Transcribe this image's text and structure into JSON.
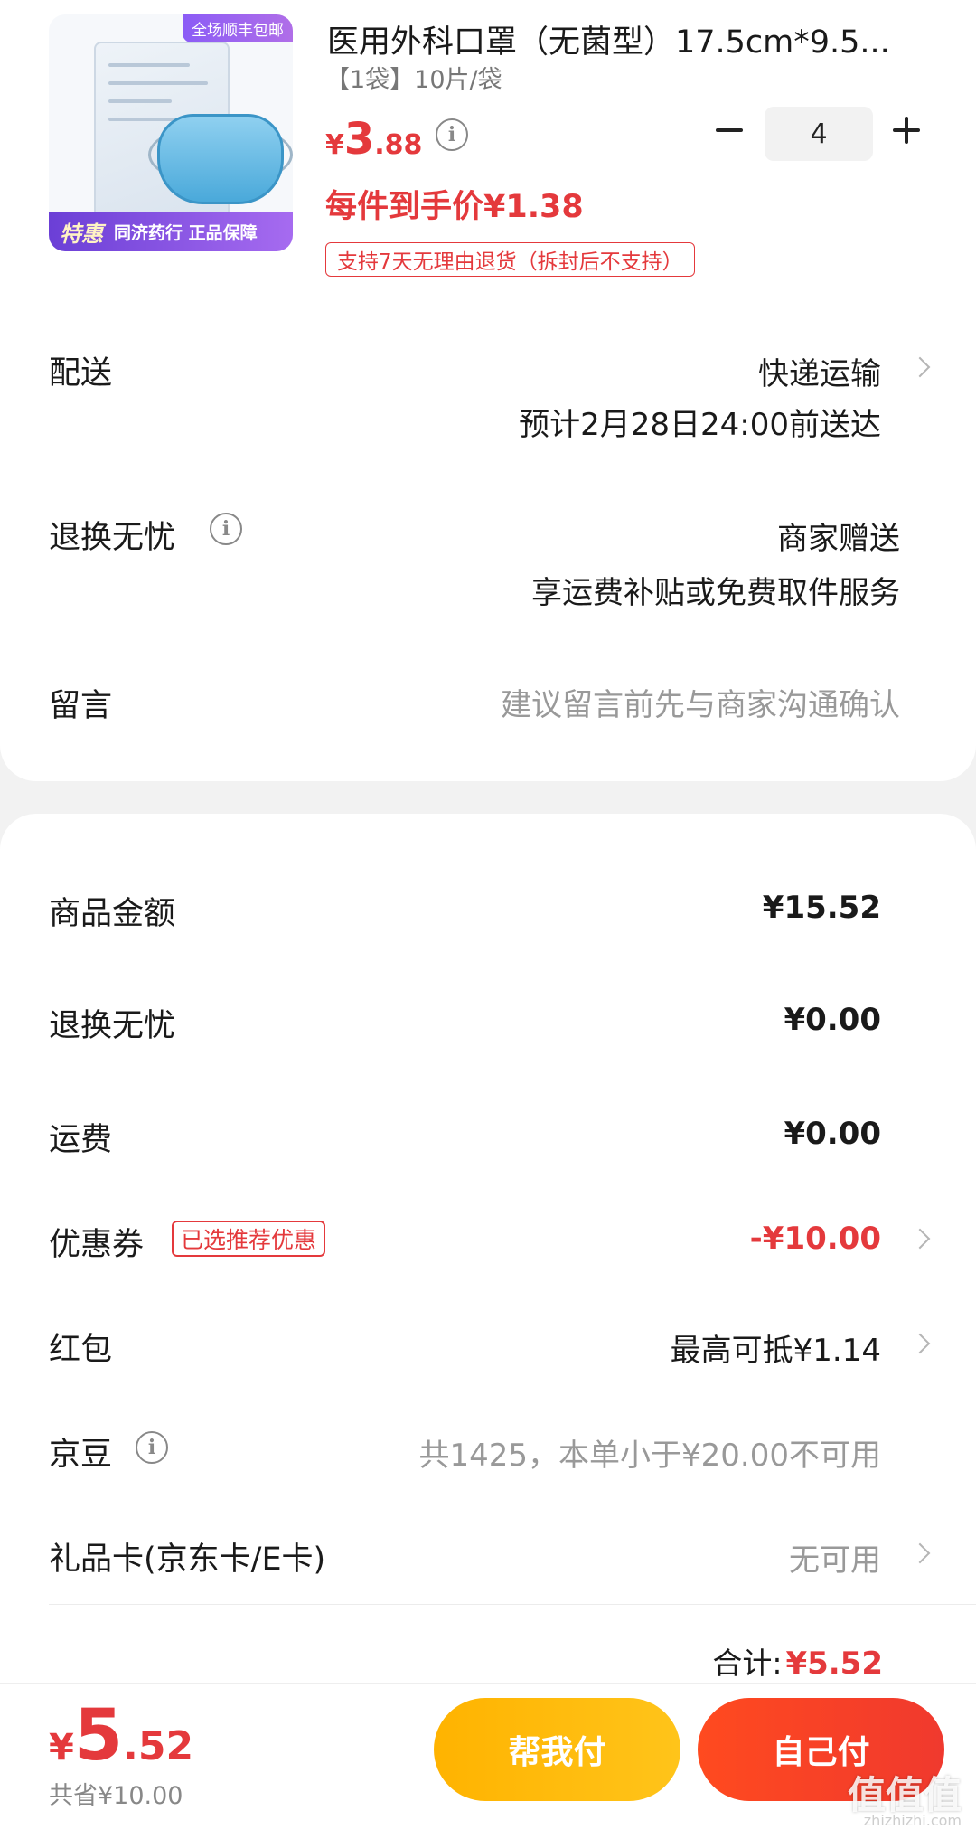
{
  "product": {
    "promo_flag": "全场顺丰包邮",
    "promo_tehui": "特惠",
    "promo_tags": "同济药行 正品保障",
    "title": "医用外科口罩（无菌型）17.5cm*9.5...",
    "spec": "【1袋】10片/袋",
    "price_symbol": "¥",
    "price_int": "3",
    "price_dec": ".88",
    "quantity": "4",
    "unit_price": "每件到手价¥1.38",
    "return_tag": "支持7天无理由退货（拆封后不支持）"
  },
  "delivery": {
    "label": "配送",
    "method": "快递运输",
    "eta": "预计2月28日24:00前送达"
  },
  "return_service": {
    "label": "退换无忧",
    "value": "商家赠送",
    "detail": "享运费补贴或免费取件服务"
  },
  "message": {
    "label": "留言",
    "placeholder": "建议留言前先与商家沟通确认"
  },
  "summary": {
    "goods_label": "商品金额",
    "goods_value": "¥15.52",
    "return_label": "退换无忧",
    "return_value": "¥0.00",
    "shipping_label": "运费",
    "shipping_value": "¥0.00",
    "coupon_label": "优惠券",
    "coupon_badge": "已选推荐优惠",
    "coupon_value": "-¥10.00",
    "redpacket_label": "红包",
    "redpacket_value": "最高可抵¥1.14",
    "jingdou_label": "京豆",
    "jingdou_value": "共1425，本单小于¥20.00不可用",
    "giftcard_label": "礼品卡(京东卡/E卡)",
    "giftcard_value": "无可用",
    "total_label": "合计:",
    "total_value": "¥5.52"
  },
  "footer": {
    "price_symbol": "¥",
    "price_int": "5",
    "price_dec": ".52",
    "saved": "共省¥10.00",
    "help_pay": "帮我付",
    "self_pay": "自己付"
  },
  "watermark": {
    "text": "值值值",
    "sub": "zhizhizhi.com"
  },
  "colors": {
    "accent_red": "#e4393c",
    "help_btn": "#ffb300",
    "self_btn": "#f0392e",
    "promo_purple": "#8b5cf6"
  }
}
